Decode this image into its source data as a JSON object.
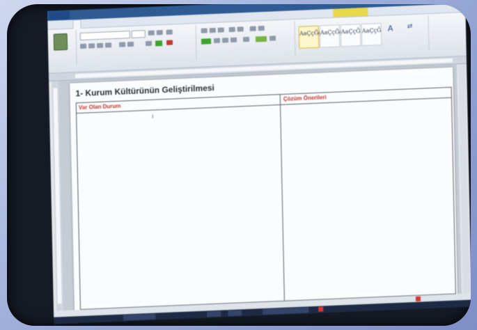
{
  "ribbon": {
    "file_tab": "",
    "title": "",
    "tabs": [
      "",
      "",
      "",
      "",
      "",
      "",
      ""
    ],
    "context_tab": "",
    "paste_label": "",
    "style_tiles": [
      {
        "sample": "AaÇçĞğ",
        "name": ""
      },
      {
        "sample": "AaÇçĞğ",
        "name": ""
      },
      {
        "sample": "AaÇçĞ",
        "name": ""
      },
      {
        "sample": "AaÇçĞ",
        "name": ""
      }
    ]
  },
  "document": {
    "heading": "1- Kurum Kültürünün Geliştirilmesi",
    "columns": [
      {
        "header": "Var Olan Durum"
      },
      {
        "header": "Çözüm Önerileri"
      }
    ],
    "heading_color": "#2b2f36",
    "column_header_color": "#c0352e"
  },
  "statusbar": {
    "text": ""
  },
  "colors": {
    "accent": "#2e5b93",
    "highlight": "#3fa42b",
    "context": "#e8d84a"
  }
}
